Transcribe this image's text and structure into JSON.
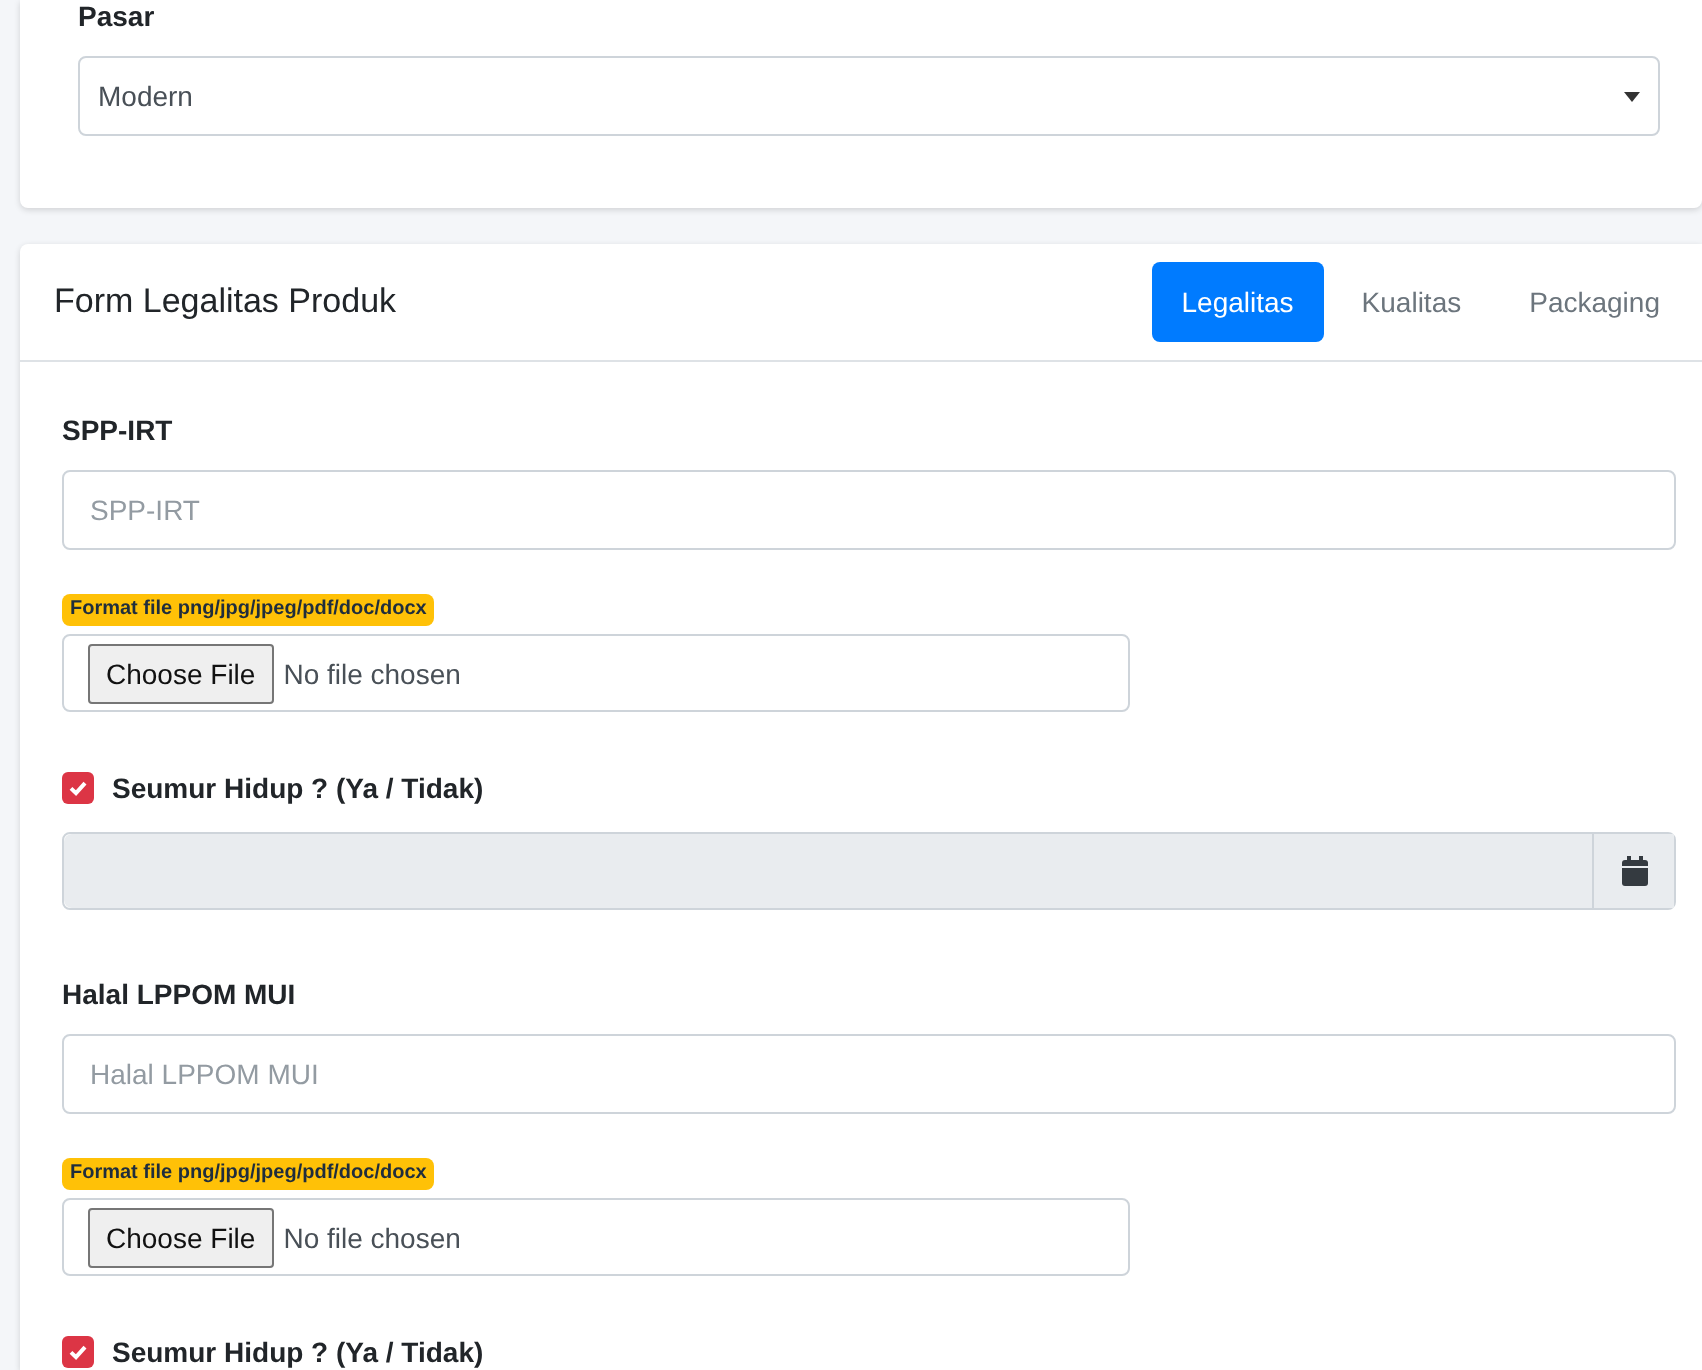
{
  "market_card": {
    "label": "Pasar",
    "select": {
      "value": "Modern"
    }
  },
  "legal_form": {
    "title": "Form Legalitas Produk",
    "tabs": [
      {
        "label": "Legalitas",
        "selected": true
      },
      {
        "label": "Kualitas",
        "selected": false
      },
      {
        "label": "Packaging",
        "selected": false
      }
    ],
    "sections": [
      {
        "label": "SPP-IRT",
        "input": {
          "placeholder": "SPP-IRT"
        },
        "file_hint": "Format file png/jpg/jpeg/pdf/doc/docx",
        "file_button": "Choose File",
        "file_status": "No file chosen",
        "lifetime": {
          "label": "Seumur Hidup ? (Ya / Tidak)",
          "checked": true
        },
        "date_field": {
          "disabled": true
        }
      },
      {
        "label": "Halal LPPOM MUI",
        "input": {
          "placeholder": "Halal LPPOM MUI"
        },
        "file_hint": "Format file png/jpg/jpeg/pdf/doc/docx",
        "file_button": "Choose File",
        "file_status": "No file chosen",
        "lifetime": {
          "label": "Seumur Hidup ? (Ya / Tidak)",
          "checked": true
        }
      }
    ]
  }
}
